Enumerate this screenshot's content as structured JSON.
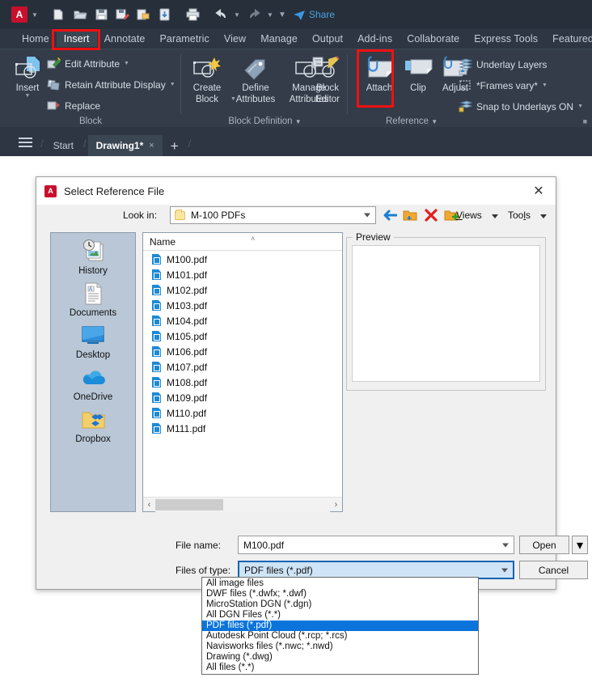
{
  "app": {
    "logo_text": "A",
    "quick_access": [
      {
        "name": "app-menu-button",
        "icon": "autocad-logo"
      },
      {
        "name": "qat-dropdown",
        "icon": "chevron-down-icon"
      },
      {
        "name": "new-button",
        "icon": "new-file-icon"
      },
      {
        "name": "open-button",
        "icon": "open-folder-icon"
      },
      {
        "name": "save-button",
        "icon": "save-disk-icon"
      },
      {
        "name": "save-as-button",
        "icon": "save-as-icon"
      },
      {
        "name": "save-to-cloud-button",
        "icon": "cloud-save-icon"
      },
      {
        "name": "open-from-cloud-button",
        "icon": "cloud-open-icon"
      },
      {
        "name": "plot-button",
        "icon": "printer-icon"
      },
      {
        "name": "undo-button",
        "icon": "undo-arrow-icon"
      },
      {
        "name": "undo-dropdown",
        "icon": "chevron-down-icon"
      },
      {
        "name": "redo-button",
        "icon": "redo-arrow-icon"
      },
      {
        "name": "redo-dropdown",
        "icon": "chevron-down-icon"
      },
      {
        "name": "customize-qat-button",
        "icon": "chevron-down-icon"
      },
      {
        "name": "share-button",
        "icon": "share-paper-plane-icon"
      }
    ],
    "share_label": "Share"
  },
  "ribbon": {
    "tabs": [
      {
        "label": "Home",
        "active": false
      },
      {
        "label": "Insert",
        "active": true
      },
      {
        "label": "Annotate",
        "active": false
      },
      {
        "label": "Parametric",
        "active": false
      },
      {
        "label": "View",
        "active": false
      },
      {
        "label": "Manage",
        "active": false
      },
      {
        "label": "Output",
        "active": false
      },
      {
        "label": "Add-ins",
        "active": false
      },
      {
        "label": "Collaborate",
        "active": false
      },
      {
        "label": "Express Tools",
        "active": false
      },
      {
        "label": "Featured",
        "active": false
      }
    ],
    "panels": {
      "block": {
        "title": "Block",
        "insert_label": "Insert",
        "items": [
          {
            "label": "Edit Attribute",
            "has_caret": true
          },
          {
            "label": "Retain Attribute Display",
            "has_caret": true
          },
          {
            "label": "Replace",
            "has_caret": false
          }
        ]
      },
      "block_definition": {
        "title": "Block Definition",
        "buttons": [
          {
            "label": "Create\nBlock",
            "line1": "Create",
            "line2": "Block",
            "has_caret": true
          },
          {
            "label": "Define\nAttributes",
            "line1": "Define",
            "line2": "Attributes",
            "has_caret": false
          },
          {
            "label": "Manage\nAttributes",
            "line1": "Manage",
            "line2": "Attributes",
            "has_caret": false
          },
          {
            "label": "Block\nEditor",
            "line1": "Block",
            "line2": "Editor",
            "has_caret": false
          }
        ]
      },
      "reference": {
        "title": "Reference",
        "buttons": [
          {
            "line1": "Attach",
            "line2": ""
          },
          {
            "line1": "Clip",
            "line2": ""
          },
          {
            "line1": "Adjust",
            "line2": ""
          }
        ],
        "items": [
          {
            "label": "Underlay Layers",
            "has_caret": false
          },
          {
            "label": "*Frames vary*",
            "has_caret": true
          },
          {
            "label": "Snap to Underlays ON",
            "has_caret": true
          }
        ]
      }
    },
    "highlight_color": "#ee1111"
  },
  "doc_tabs": {
    "menu_icon": "hamburger-menu-icon",
    "tabs": [
      {
        "label": "Start",
        "active": false,
        "closable": false
      },
      {
        "label": "Drawing1*",
        "active": true,
        "closable": true
      }
    ],
    "close_glyph": "×",
    "new_tab_glyph": "+"
  },
  "dialog": {
    "title": "Select Reference File",
    "close_glyph": "✕",
    "lookin": {
      "label": "Look in:",
      "value": "M-100 PDFs"
    },
    "nav_buttons": [
      {
        "name": "back-button",
        "icon": "back-arrow-icon"
      },
      {
        "name": "up-one-level-button",
        "icon": "up-folder-icon"
      },
      {
        "name": "delete-button",
        "icon": "red-x-icon"
      },
      {
        "name": "new-folder-button",
        "icon": "new-folder-icon"
      }
    ],
    "views_label": "Views",
    "tools_label": "Tools",
    "places": [
      {
        "label": "History",
        "icon": "history-clock-icon"
      },
      {
        "label": "Documents",
        "icon": "documents-icon"
      },
      {
        "label": "Desktop",
        "icon": "desktop-monitor-icon"
      },
      {
        "label": "OneDrive",
        "icon": "onedrive-cloud-icon"
      },
      {
        "label": "Dropbox",
        "icon": "dropbox-folder-icon"
      }
    ],
    "file_list": {
      "column_header": "Name",
      "sort_glyph": "˄",
      "files": [
        "M100.pdf",
        "M101.pdf",
        "M102.pdf",
        "M103.pdf",
        "M104.pdf",
        "M105.pdf",
        "M106.pdf",
        "M107.pdf",
        "M108.pdf",
        "M109.pdf",
        "M110.pdf",
        "M111.pdf"
      ],
      "scroll_left_glyph": "‹",
      "scroll_right_glyph": "›"
    },
    "preview": {
      "legend": "Preview"
    },
    "file_name": {
      "label": "File name:",
      "value": "M100.pdf"
    },
    "files_of_type": {
      "label": "Files of type:",
      "value": "PDF files (*.pdf)",
      "options": [
        {
          "label": "All image files",
          "selected": false
        },
        {
          "label": "DWF files (*.dwfx; *.dwf)",
          "selected": false
        },
        {
          "label": "MicroStation DGN (*.dgn)",
          "selected": false
        },
        {
          "label": "All DGN Files (*.*)",
          "selected": false
        },
        {
          "label": "PDF files (*.pdf)",
          "selected": true
        },
        {
          "label": "Autodesk Point Cloud (*.rcp; *.rcs)",
          "selected": false
        },
        {
          "label": "Navisworks files (*.nwc; *.nwd)",
          "selected": false
        },
        {
          "label": "Drawing (*.dwg)",
          "selected": false
        },
        {
          "label": "All files (*.*)",
          "selected": false
        }
      ]
    },
    "open_label": "Open",
    "open_split_glyph": "▾",
    "cancel_label": "Cancel"
  },
  "colors": {
    "accent_red": "#c8102e",
    "highlight_red": "#ee1111",
    "ribbon_bg": "#333c48",
    "titlebar_bg": "#262f3a",
    "places_bg": "#b9c7d6",
    "selection_blue": "#0a74dc",
    "share_blue": "#4aa3e0"
  }
}
